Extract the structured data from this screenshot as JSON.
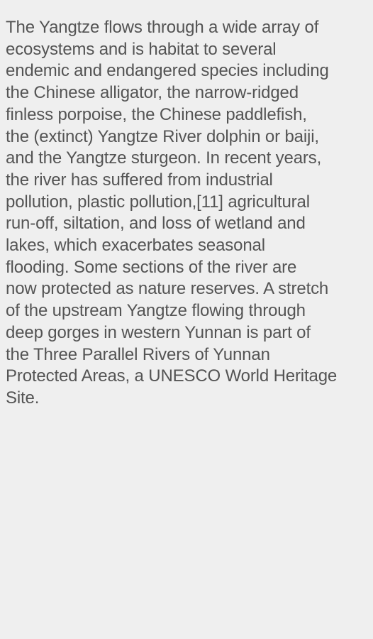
{
  "screen": {
    "background_color": "#efefef",
    "text_color": "#545454"
  },
  "article": {
    "lines": [
      "The Yangtze flows through a wide array of",
      "ecosystems and is habitat to several",
      "endemic and endangered species including",
      "the Chinese alligator, the narrow-ridged",
      "finless porpoise, the Chinese paddlefish,",
      "the (extinct) Yangtze River dolphin or baiji,",
      "and the Yangtze sturgeon. In recent years,",
      "the river has suffered from industrial",
      "pollution, plastic pollution,[11] agricultural",
      "run-off, siltation, and loss of wetland and",
      "lakes, which exacerbates seasonal",
      "flooding. Some sections of the river are",
      "now protected as nature reserves. A stretch",
      "of the upstream Yangtze flowing through",
      "deep gorges in western Yunnan is part of",
      "the Three Parallel Rivers of Yunnan",
      "Protected Areas, a UNESCO World Heritage",
      "Site."
    ]
  }
}
